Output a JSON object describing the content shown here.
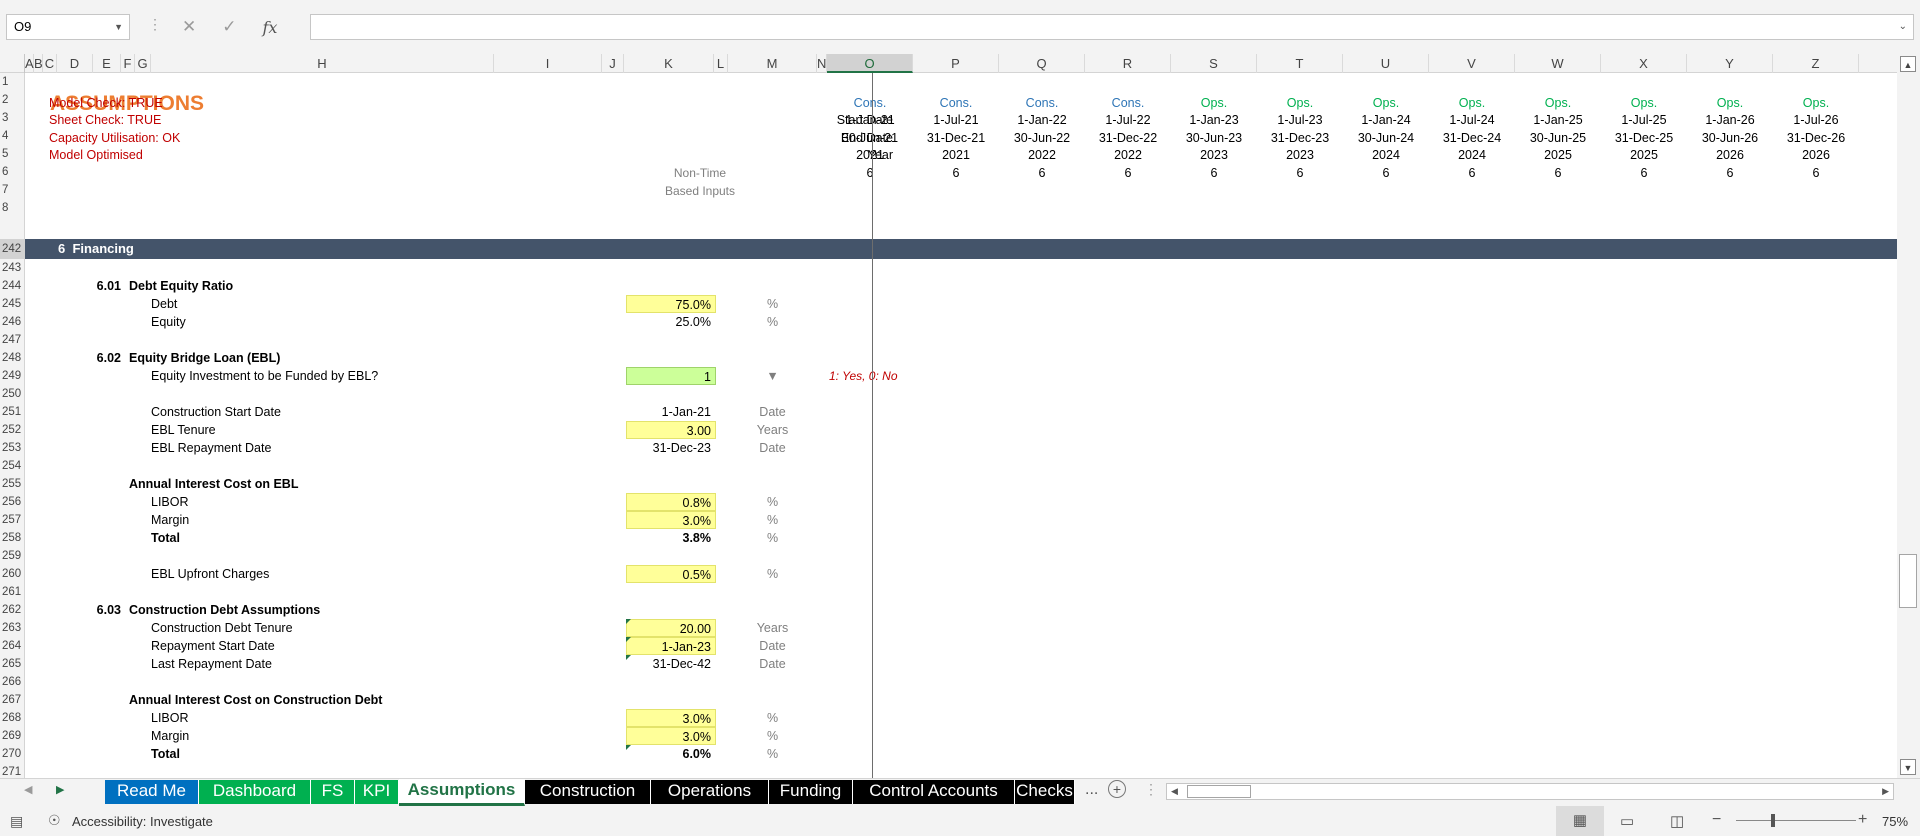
{
  "name_box": "O9",
  "formula_bar": {
    "cancel_icon": "✕",
    "enter_icon": "✓",
    "fx_label": "fx",
    "formula": ""
  },
  "columns": [
    {
      "id": "A",
      "w": 9
    },
    {
      "id": "B",
      "w": 9
    },
    {
      "id": "C",
      "w": 14
    },
    {
      "id": "D",
      "w": 36
    },
    {
      "id": "E",
      "w": 28
    },
    {
      "id": "F",
      "w": 14
    },
    {
      "id": "G",
      "w": 16
    },
    {
      "id": "H",
      "w": 343
    },
    {
      "id": "I",
      "w": 108
    },
    {
      "id": "J",
      "w": 22
    },
    {
      "id": "K",
      "w": 90
    },
    {
      "id": "L",
      "w": 14
    },
    {
      "id": "M",
      "w": 89
    },
    {
      "id": "N",
      "w": 10
    },
    {
      "id": "O",
      "w": 86
    },
    {
      "id": "P",
      "w": 86
    },
    {
      "id": "Q",
      "w": 86
    },
    {
      "id": "R",
      "w": 86
    },
    {
      "id": "S",
      "w": 86
    },
    {
      "id": "T",
      "w": 86
    },
    {
      "id": "U",
      "w": 86
    },
    {
      "id": "V",
      "w": 86
    },
    {
      "id": "W",
      "w": 86
    },
    {
      "id": "X",
      "w": 86
    },
    {
      "id": "Y",
      "w": 86
    },
    {
      "id": "Z",
      "w": 86
    }
  ],
  "selected_column": "O",
  "rows": [
    "1",
    "2",
    "3",
    "4",
    "5",
    "6",
    "7",
    "8",
    "242",
    "243",
    "244",
    "245",
    "246",
    "247",
    "248",
    "249",
    "250",
    "251",
    "252",
    "253",
    "254",
    "255",
    "256",
    "257",
    "258",
    "259",
    "260",
    "261",
    "262",
    "263",
    "264",
    "265",
    "266",
    "267",
    "268",
    "269",
    "270",
    "271"
  ],
  "header": {
    "title": "ASSUMPTIONS",
    "checks": [
      "Model Check: TRUE",
      "Sheet Check: TRUE",
      "Capacity Utilisation: OK",
      "Model Optimised"
    ],
    "timeline_labels": [
      "Start Date",
      "End Date",
      "Year"
    ],
    "non_time_label": [
      "Non-Time",
      "Based Inputs"
    ]
  },
  "timeline": [
    {
      "type": "Cons.",
      "start": "1-Jan-21",
      "end": "30-Jun-21",
      "year": "2021",
      "n": "6"
    },
    {
      "type": "Cons.",
      "start": "1-Jul-21",
      "end": "31-Dec-21",
      "year": "2021",
      "n": "6"
    },
    {
      "type": "Cons.",
      "start": "1-Jan-22",
      "end": "30-Jun-22",
      "year": "2022",
      "n": "6"
    },
    {
      "type": "Cons.",
      "start": "1-Jul-22",
      "end": "31-Dec-22",
      "year": "2022",
      "n": "6"
    },
    {
      "type": "Ops.",
      "start": "1-Jan-23",
      "end": "30-Jun-23",
      "year": "2023",
      "n": "6"
    },
    {
      "type": "Ops.",
      "start": "1-Jul-23",
      "end": "31-Dec-23",
      "year": "2023",
      "n": "6"
    },
    {
      "type": "Ops.",
      "start": "1-Jan-24",
      "end": "30-Jun-24",
      "year": "2024",
      "n": "6"
    },
    {
      "type": "Ops.",
      "start": "1-Jul-24",
      "end": "31-Dec-24",
      "year": "2024",
      "n": "6"
    },
    {
      "type": "Ops.",
      "start": "1-Jan-25",
      "end": "30-Jun-25",
      "year": "2025",
      "n": "6"
    },
    {
      "type": "Ops.",
      "start": "1-Jul-25",
      "end": "31-Dec-25",
      "year": "2025",
      "n": "6"
    },
    {
      "type": "Ops.",
      "start": "1-Jan-26",
      "end": "30-Jun-26",
      "year": "2026",
      "n": "6"
    },
    {
      "type": "Ops.",
      "start": "1-Jul-26",
      "end": "31-Dec-26",
      "year": "2026",
      "n": "6"
    }
  ],
  "section": {
    "num": "6",
    "title": "Financing"
  },
  "items": [
    {
      "row": "244",
      "num": "6.01",
      "label": "Debt Equity Ratio",
      "kind": "sub"
    },
    {
      "row": "245",
      "label": "Debt",
      "value": "75.0%",
      "unit": "%",
      "style": "yellow"
    },
    {
      "row": "246",
      "label": "Equity",
      "value": "25.0%",
      "unit": "%",
      "style": "plain"
    },
    {
      "row": "248",
      "num": "6.02",
      "label": "Equity Bridge Loan (EBL)",
      "kind": "sub"
    },
    {
      "row": "249",
      "label": "Equity Investment to be Funded by EBL?",
      "value": "1",
      "unit": "▼",
      "style": "green",
      "note": "1: Yes, 0: No"
    },
    {
      "row": "251",
      "label": "Construction Start Date",
      "value": "1-Jan-21",
      "unit": "Date",
      "style": "plain"
    },
    {
      "row": "252",
      "label": "EBL Tenure",
      "value": "3.00",
      "unit": "Years",
      "style": "yellow"
    },
    {
      "row": "253",
      "label": "EBL Repayment Date",
      "value": "31-Dec-23",
      "unit": "Date",
      "style": "plain"
    },
    {
      "row": "255",
      "label": "Annual Interest Cost on EBL",
      "kind": "group"
    },
    {
      "row": "256",
      "label": "LIBOR",
      "value": "0.8%",
      "unit": "%",
      "style": "yellow"
    },
    {
      "row": "257",
      "label": "Margin",
      "value": "3.0%",
      "unit": "%",
      "style": "yellow"
    },
    {
      "row": "258",
      "label": "Total",
      "value": "3.8%",
      "unit": "%",
      "style": "plain",
      "bold": true
    },
    {
      "row": "260",
      "label": "EBL Upfront Charges",
      "value": "0.5%",
      "unit": "%",
      "style": "yellow"
    },
    {
      "row": "262",
      "num": "6.03",
      "label": "Construction Debt Assumptions",
      "kind": "sub"
    },
    {
      "row": "263",
      "label": "Construction Debt Tenure",
      "value": "20.00",
      "unit": "Years",
      "style": "yellow",
      "tri": true
    },
    {
      "row": "264",
      "label": "Repayment Start Date",
      "value": "1-Jan-23",
      "unit": "Date",
      "style": "yellow",
      "tri": true
    },
    {
      "row": "265",
      "label": "Last Repayment Date",
      "value": "31-Dec-42",
      "unit": "Date",
      "style": "plain",
      "tri": true
    },
    {
      "row": "267",
      "label": "Annual Interest Cost on Construction Debt",
      "kind": "group"
    },
    {
      "row": "268",
      "label": "LIBOR",
      "value": "3.0%",
      "unit": "%",
      "style": "yellow"
    },
    {
      "row": "269",
      "label": "Margin",
      "value": "3.0%",
      "unit": "%",
      "style": "yellow"
    },
    {
      "row": "270",
      "label": "Total",
      "value": "6.0%",
      "unit": "%",
      "style": "plain",
      "bold": true,
      "tri": true
    }
  ],
  "sheet_tabs": [
    {
      "label": "Read Me",
      "color": "#0070c0"
    },
    {
      "label": "Dashboard",
      "color": "#00b050"
    },
    {
      "label": "FS",
      "color": "#00b050"
    },
    {
      "label": "KPI",
      "color": "#00b050"
    },
    {
      "label": "Assumptions",
      "color": "#ffffff",
      "active": true
    },
    {
      "label": "Construction",
      "color": "#000000"
    },
    {
      "label": "Operations",
      "color": "#000000"
    },
    {
      "label": "Funding",
      "color": "#000000"
    },
    {
      "label": "Control Accounts",
      "color": "#000000"
    },
    {
      "label": "Checks",
      "color": "#000000"
    }
  ],
  "tab_more": "...",
  "status": {
    "accessibility": "Accessibility: Investigate",
    "zoom": "75%"
  },
  "colors": {
    "title": "#ed7d31",
    "check_red": "#c00000",
    "banner": "#44546a",
    "cons": "#2e75b6",
    "ops": "#00b050",
    "input_yellow": "#ffff99",
    "input_green": "#ccff99"
  }
}
